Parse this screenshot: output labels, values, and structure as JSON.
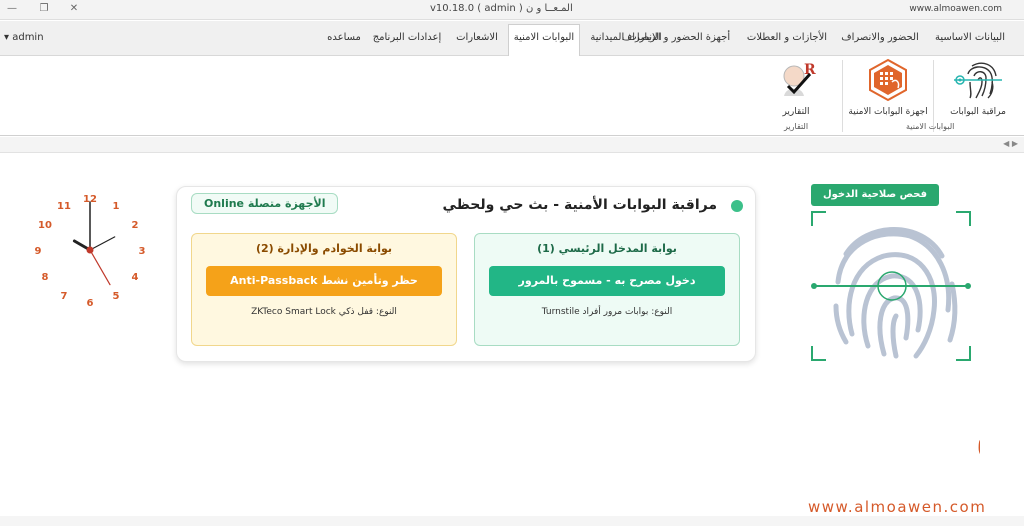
{
  "window": {
    "title": "v10.18.0 ( admin ) المـعــا و ن",
    "url": "www.almoawen.com",
    "controls": [
      "—",
      "❐",
      "✕"
    ]
  },
  "user": {
    "name": "admin",
    "arrow": "▾"
  },
  "tabs": [
    {
      "label": "البيانات الاساسية",
      "active": false
    },
    {
      "label": "الحضور والانصراف",
      "active": false
    },
    {
      "label": "الأجازات و العطلات",
      "active": false
    },
    {
      "label": "أجهزة الحضور و الانصراف",
      "active": false
    },
    {
      "label": "الزيارات الميدانية",
      "active": false
    },
    {
      "label": "البوابات الامنية",
      "active": true
    },
    {
      "label": "الاشعارات",
      "active": false
    },
    {
      "label": "إعدادات البرنامج",
      "active": false
    },
    {
      "label": "مساعده",
      "active": false
    }
  ],
  "ribbon": {
    "gates_group": "البوابات الامنية",
    "reports_group": "التقارير",
    "gate_monitor": "مراقبة البوابات",
    "gate_devices": "اجهزة البوابات الامنية",
    "reports": "التقارير"
  },
  "strip": {
    "arrows": "◀ ▶"
  },
  "clock": {
    "numbers": [
      "12",
      "1",
      "2",
      "3",
      "4",
      "5",
      "6",
      "7",
      "8",
      "9",
      "10",
      "11"
    ],
    "hour_angle": 300,
    "minute_angle": 0,
    "second_angle": 150
  },
  "panel": {
    "title": "مراقبة البوابات الأمنية - بث حي ولحظي",
    "online": "الأجهزة متصلة Online",
    "gates": [
      {
        "name": "بوابة المدخل الرئيسي (1)",
        "status": "دخول مصرح به - مسموح بالمرور",
        "type": "النوع: بوابات مرور أفراد Turnstile"
      },
      {
        "name": "بوابة الخوادم والإدارة (2)",
        "status": "حظر وتأمين نشط Anti-Passback",
        "type": "النوع: قفل ذكي ZKTeco Smart Lock"
      }
    ]
  },
  "verify": {
    "label": "فحص صلاحية الدخول"
  },
  "brand": {
    "arabic": "المعاون",
    "url": "www.almoawen.com"
  },
  "colors": {
    "accent": "#d55a2a",
    "success": "#22b686",
    "warning": "#f5a219"
  }
}
